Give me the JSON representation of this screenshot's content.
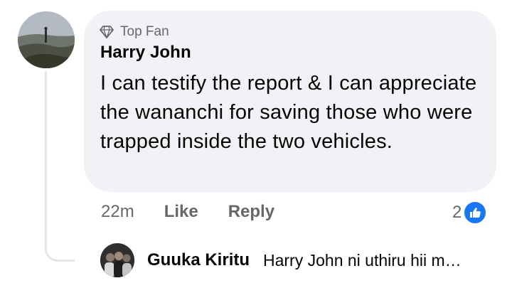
{
  "comment": {
    "badge": "Top Fan",
    "badge_icon": "diamond-icon",
    "author": "Harry John",
    "text": "I can testify the report & I can appreciate the wananchi for saving those who were trapped inside the two vehicles.",
    "time": "22m",
    "like_label": "Like",
    "reply_label": "Reply",
    "reaction_count": "2",
    "reaction_icon": "like-thumb-icon",
    "bubble_color": "#f0f2f5",
    "reaction_color": "#1877f2"
  },
  "reply_preview": {
    "author": "Guuka Kiritu",
    "text": "Harry John ni uthiru hii m…"
  }
}
